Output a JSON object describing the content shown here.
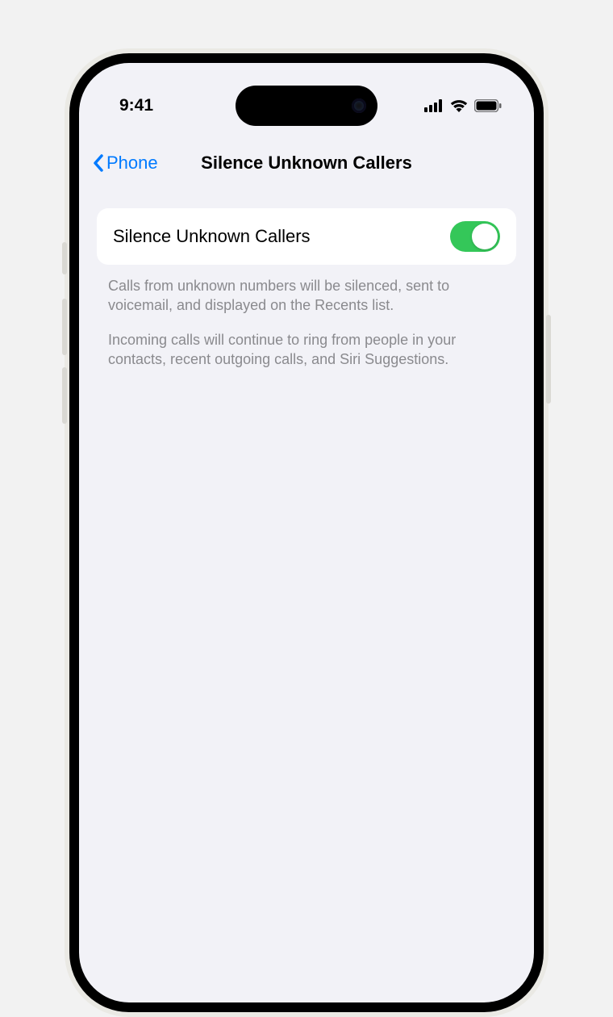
{
  "status": {
    "time": "9:41"
  },
  "nav": {
    "back_label": "Phone",
    "title": "Silence Unknown Callers"
  },
  "setting": {
    "label": "Silence Unknown Callers",
    "enabled": true
  },
  "footer": {
    "para1": "Calls from unknown numbers will be silenced, sent to voicemail, and displayed on the Recents list.",
    "para2": "Incoming calls will continue to ring from people in your contacts, recent outgoing calls, and Siri Suggestions."
  },
  "colors": {
    "accent": "#007aff",
    "toggle_on": "#34c759",
    "background": "#f2f2f7",
    "row_bg": "#ffffff",
    "footer_text": "#8a8a8e"
  }
}
